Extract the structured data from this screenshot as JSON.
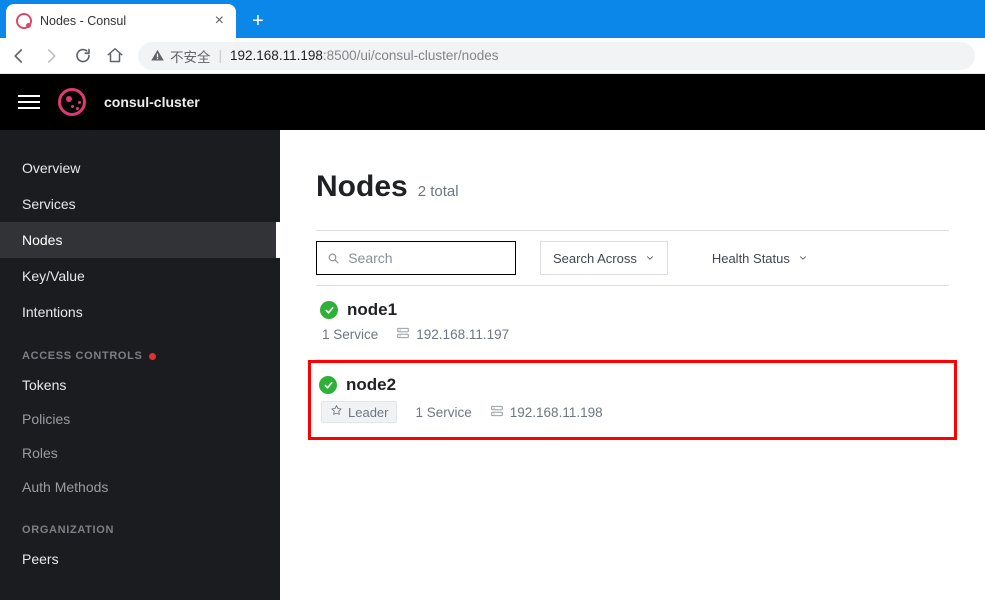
{
  "browser": {
    "tab_title": "Nodes - Consul",
    "not_secure_label": "不安全",
    "url_host": "192.168.11.198",
    "url_port_path": ":8500/ui/consul-cluster/nodes"
  },
  "header": {
    "cluster_name": "consul-cluster"
  },
  "sidebar": {
    "items": [
      "Overview",
      "Services",
      "Nodes",
      "Key/Value",
      "Intentions"
    ],
    "active_index": 2,
    "access_controls_label": "ACCESS CONTROLS",
    "access_items": [
      "Tokens",
      "Policies",
      "Roles",
      "Auth Methods"
    ],
    "organization_label": "ORGANIZATION",
    "org_items": [
      "Peers"
    ]
  },
  "page": {
    "title": "Nodes",
    "total_label": "2 total",
    "search_placeholder": "Search",
    "search_across_label": "Search Across",
    "health_status_label": "Health Status"
  },
  "nodes": [
    {
      "name": "node1",
      "status": "passing",
      "leader": false,
      "services_label": "1 Service",
      "address": "192.168.11.197",
      "highlight": false
    },
    {
      "name": "node2",
      "status": "passing",
      "leader": true,
      "leader_label": "Leader",
      "services_label": "1 Service",
      "address": "192.168.11.198",
      "highlight": true
    }
  ]
}
